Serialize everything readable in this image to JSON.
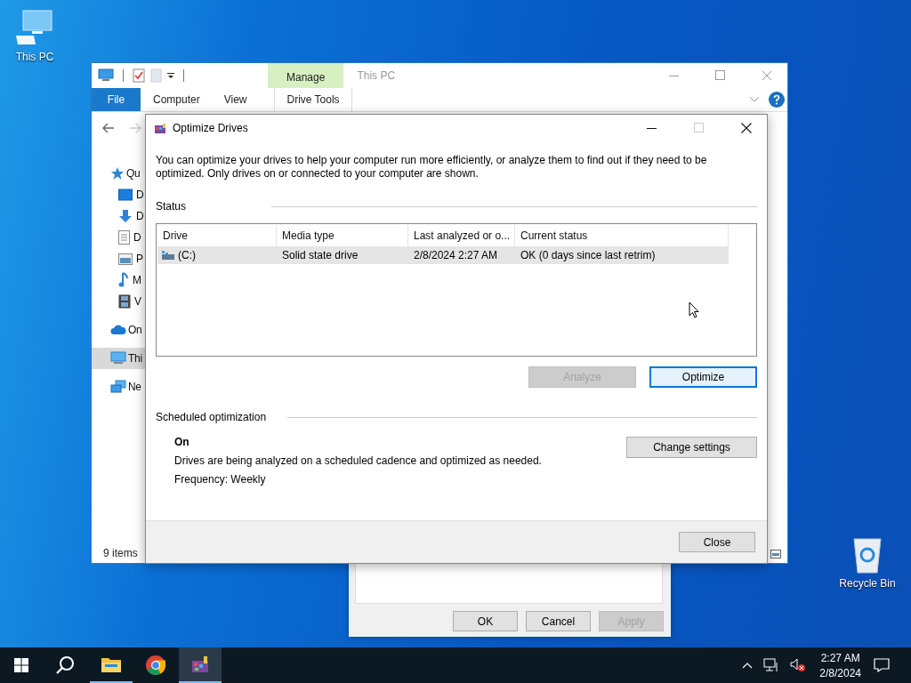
{
  "desktop_icons": [
    {
      "label": "This PC",
      "kind": "computer"
    },
    {
      "label": "Recycle Bin",
      "kind": "recycle"
    }
  ],
  "explorer": {
    "title": "This PC",
    "context_tab": "Manage",
    "ribbon_tabs": [
      {
        "label": "File",
        "kind": "file"
      },
      {
        "label": "Computer",
        "kind": "tab"
      },
      {
        "label": "View",
        "kind": "tab"
      },
      {
        "label": "Drive Tools",
        "kind": "context"
      }
    ],
    "sidebar": [
      {
        "label": "Qu",
        "kind": "star",
        "selected": false,
        "children": [
          {
            "label": "D",
            "kind": "desktop",
            "selected": false
          },
          {
            "label": "D",
            "kind": "download",
            "selected": false
          },
          {
            "label": "D",
            "kind": "document",
            "selected": false
          },
          {
            "label": "P",
            "kind": "picture",
            "selected": false
          },
          {
            "label": "M",
            "kind": "music",
            "selected": false
          },
          {
            "label": "V",
            "kind": "video",
            "selected": false
          }
        ]
      },
      {
        "label": "On",
        "kind": "cloud",
        "selected": false
      },
      {
        "label": "Thi",
        "kind": "pc",
        "selected": true
      },
      {
        "label": "Ne",
        "kind": "network",
        "selected": false
      }
    ],
    "status": "9 items"
  },
  "properties_dialog": {
    "buttons": [
      {
        "label": "OK",
        "disabled": false
      },
      {
        "label": "Cancel",
        "disabled": false
      },
      {
        "label": "Apply",
        "disabled": true
      }
    ]
  },
  "optimize": {
    "title": "Optimize Drives",
    "intro": "You can optimize your drives to help your computer run more efficiently, or analyze them to find out if they need to be optimized. Only drives on or connected to your computer are shown.",
    "status_heading": "Status",
    "columns": [
      "Drive",
      "Media type",
      "Last analyzed or o...",
      "Current status"
    ],
    "rows": [
      {
        "drive": "(C:)",
        "media": "Solid state drive",
        "last": "2/8/2024 2:27 AM",
        "status": "OK (0 days since last retrim)",
        "selected": true
      }
    ],
    "actions": [
      {
        "label": "Analyze",
        "disabled": true,
        "default": false
      },
      {
        "label": "Optimize",
        "disabled": false,
        "default": true
      }
    ],
    "schedule_heading": "Scheduled optimization",
    "schedule_state": "On",
    "schedule_description": "Drives are being analyzed on a scheduled cadence and optimized as needed.",
    "frequency": "Frequency: Weekly",
    "change_button": "Change settings",
    "close_button": "Close"
  },
  "taskbar": {
    "apps": [
      {
        "kind": "folder",
        "running": true,
        "active": false
      },
      {
        "kind": "browser",
        "running": false,
        "active": false
      },
      {
        "kind": "defrag",
        "running": true,
        "active": true
      }
    ],
    "time": "2:27 AM",
    "date": "2/8/2024"
  }
}
